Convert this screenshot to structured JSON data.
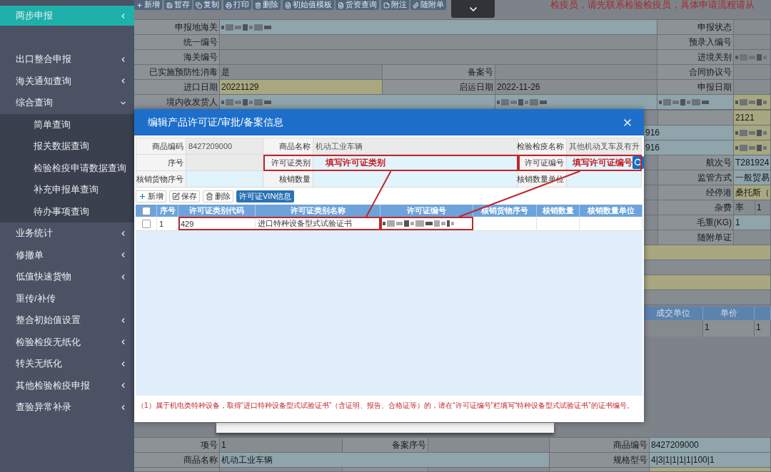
{
  "sidebar": {
    "items": [
      {
        "label": "两步申报",
        "kind": "group",
        "selected": true,
        "expanded": false
      },
      {
        "label": "出口整合申报",
        "kind": "group",
        "selected": false,
        "expanded": false
      },
      {
        "label": "海关通知查询",
        "kind": "group",
        "selected": false,
        "expanded": false
      },
      {
        "label": "综合查询",
        "kind": "group",
        "selected": false,
        "expanded": true,
        "children": [
          {
            "label": "简单查询",
            "selected": false
          },
          {
            "label": "报关数据查询",
            "selected": false
          },
          {
            "label": "检验检疫申请数据查询",
            "selected": false
          },
          {
            "label": "补充申报单查询",
            "selected": false
          },
          {
            "label": "待办事项查询",
            "selected": false
          }
        ]
      },
      {
        "label": "业务统计",
        "kind": "group",
        "selected": false,
        "expanded": false
      },
      {
        "label": "修撤单",
        "kind": "group",
        "selected": false,
        "expanded": false
      },
      {
        "label": "低值快速货物",
        "kind": "group",
        "selected": false,
        "expanded": false
      },
      {
        "label": "重传/补传",
        "kind": "link",
        "selected": false
      },
      {
        "label": "整合初始值设置",
        "kind": "group",
        "selected": false,
        "expanded": false
      },
      {
        "label": "检验检疫无纸化",
        "kind": "group",
        "selected": false,
        "expanded": false
      },
      {
        "label": "转关无纸化",
        "kind": "group",
        "selected": false,
        "expanded": false
      },
      {
        "label": "其他检验检疫申报",
        "kind": "group",
        "selected": false,
        "expanded": false
      },
      {
        "label": "查验异常补录",
        "kind": "group",
        "selected": false,
        "expanded": false
      }
    ]
  },
  "page_toolbar": {
    "buttons": [
      {
        "label": "新增",
        "kind": "add"
      },
      {
        "label": "暂存",
        "kind": "save"
      },
      {
        "label": "复制",
        "kind": "copy"
      },
      {
        "label": "打印",
        "kind": "print"
      },
      {
        "label": "删除",
        "kind": "delete"
      },
      {
        "label": "初始值模板",
        "kind": "template"
      },
      {
        "label": "货资查询",
        "kind": "query"
      },
      {
        "label": "附注",
        "kind": "note"
      },
      {
        "label": "随附单",
        "kind": "attachment"
      }
    ],
    "notice": "检疫员，请先联系检验检疫员，具体申请流程请从"
  },
  "viewer_toggle": {
    "expanded": false
  },
  "declaration_form": {
    "rows": [
      {
        "cells": [
          {
            "kind": "label",
            "text": "申报地海关"
          },
          {
            "kind": "input",
            "redacted": true
          },
          {
            "kind": "merged"
          },
          {
            "kind": "merged"
          },
          {
            "kind": "label",
            "text": "申报状态"
          },
          {
            "kind": "readonly"
          }
        ]
      },
      {
        "cells": [
          {
            "kind": "label",
            "text": "统一编号"
          },
          {
            "kind": "readonly"
          },
          {
            "kind": "merged"
          },
          {
            "kind": "merged"
          },
          {
            "kind": "label",
            "text": "预录入编号"
          },
          {
            "kind": "readonly"
          }
        ]
      },
      {
        "cells": [
          {
            "kind": "label",
            "text": "海关编号"
          },
          {
            "kind": "readonly"
          },
          {
            "kind": "merged"
          },
          {
            "kind": "merged"
          },
          {
            "kind": "label",
            "text": "进境关别"
          },
          {
            "kind": "readonly",
            "redacted": true
          }
        ]
      },
      {
        "cells": [
          {
            "kind": "label",
            "text": "已实施预防性消毒"
          },
          {
            "kind": "readonly",
            "text": "是"
          },
          {
            "kind": "label",
            "text": "备案号"
          },
          {
            "kind": "readonly"
          },
          {
            "kind": "label",
            "text": "合同协议号"
          },
          {
            "kind": "readonly"
          }
        ]
      },
      {
        "cells": [
          {
            "kind": "label",
            "text": "进口日期"
          },
          {
            "kind": "required",
            "text": "20221129"
          },
          {
            "kind": "label",
            "text": "启运日期"
          },
          {
            "kind": "readonly",
            "text": "2022-11-26"
          },
          {
            "kind": "label",
            "text": "申报日期"
          },
          {
            "kind": "readonly"
          }
        ]
      },
      {
        "cells": [
          {
            "kind": "label",
            "text": "境内收发货人"
          },
          {
            "kind": "input",
            "redacted": true
          },
          {
            "kind": "merged"
          },
          {
            "kind": "input",
            "redacted": true
          },
          {
            "kind": "input",
            "redacted": true
          },
          {
            "kind": "required",
            "redacted": true
          }
        ]
      }
    ]
  },
  "side_panel": {
    "rows": [
      {
        "cells": [
          {
            "kind": "blank"
          },
          {
            "kind": "label"
          },
          {
            "kind": "required",
            "text": "2121"
          },
          {
            "kind": "merged"
          }
        ]
      },
      {
        "cells": [
          {
            "kind": "input",
            "text": "916"
          },
          {
            "kind": "merged"
          },
          {
            "kind": "required",
            "redacted": true
          },
          {
            "kind": "merged"
          }
        ]
      },
      {
        "cells": [
          {
            "kind": "input",
            "text": "916"
          },
          {
            "kind": "merged"
          },
          {
            "kind": "required",
            "redacted": true
          },
          {
            "kind": "merged"
          }
        ]
      },
      {
        "cells": [
          {
            "kind": "blank"
          },
          {
            "kind": "label",
            "text": "航次号"
          },
          {
            "kind": "input",
            "text": "T281924"
          },
          {
            "kind": "merged"
          }
        ]
      },
      {
        "cells": [
          {
            "kind": "blank"
          },
          {
            "kind": "label",
            "text": "监管方式"
          },
          {
            "kind": "input",
            "text": "一般贸易"
          },
          {
            "kind": "merged"
          }
        ]
      },
      {
        "cells": [
          {
            "kind": "blank"
          },
          {
            "kind": "label",
            "text": "经停港"
          },
          {
            "kind": "required",
            "text": "桑托斯（"
          },
          {
            "kind": "merged"
          }
        ]
      },
      {
        "cells": [
          {
            "kind": "blank"
          },
          {
            "kind": "label",
            "text": "杂费"
          },
          {
            "kind": "readonly",
            "text": "率"
          },
          {
            "kind": "readonly",
            "text": "1"
          }
        ]
      },
      {
        "cells": [
          {
            "kind": "blank"
          },
          {
            "kind": "label",
            "text": "毛重(KG)"
          },
          {
            "kind": "input",
            "text": "1"
          },
          {
            "kind": "merged"
          }
        ]
      },
      {
        "cells": [
          {
            "kind": "blank"
          },
          {
            "kind": "label",
            "text": "随附单证"
          },
          {
            "kind": "readonly"
          },
          {
            "kind": "merged"
          }
        ]
      },
      {
        "cells": [
          {
            "kind": "required"
          },
          {
            "kind": "merged"
          },
          {
            "kind": "merged"
          },
          {
            "kind": "merged"
          }
        ]
      },
      {
        "cells": [
          {
            "kind": "readonly"
          },
          {
            "kind": "merged"
          },
          {
            "kind": "merged"
          },
          {
            "kind": "merged"
          }
        ]
      },
      {
        "cells": [
          {
            "kind": "required"
          },
          {
            "kind": "merged"
          },
          {
            "kind": "merged"
          },
          {
            "kind": "merged"
          }
        ]
      },
      {
        "cells": [
          {
            "kind": "readonly"
          },
          {
            "kind": "merged"
          },
          {
            "kind": "merged"
          },
          {
            "kind": "merged"
          }
        ]
      }
    ],
    "table": {
      "columns": [
        "成交单位",
        "单价"
      ],
      "rows": [
        {
          "cells": [
            {
              "kind": "blank"
            },
            {
              "kind": "value",
              "text": "1"
            },
            {
              "kind": "value",
              "text": "1"
            }
          ]
        }
      ]
    }
  },
  "bottom_form": {
    "rows": [
      {
        "cells": [
          {
            "kind": "label",
            "text": "项号"
          },
          {
            "kind": "readonly",
            "text": "1"
          },
          {
            "kind": "label",
            "text": "备案序号"
          },
          {
            "kind": "readonly"
          },
          {
            "kind": "label",
            "text": "商品编号"
          },
          {
            "kind": "input",
            "text": "8427209000"
          }
        ]
      },
      {
        "cells": [
          {
            "kind": "label",
            "text": "商品名称"
          },
          {
            "kind": "input",
            "text": "机动工业车辆"
          },
          {
            "kind": "merged"
          },
          {
            "kind": "merged"
          },
          {
            "kind": "label",
            "text": "规格型号"
          },
          {
            "kind": "input",
            "text": "4|3|1|1|1|1|100|1"
          }
        ]
      },
      {
        "cells": [
          {
            "kind": "label"
          },
          {
            "kind": "readonly"
          },
          {
            "kind": "label"
          },
          {
            "kind": "readonly"
          },
          {
            "kind": "label"
          },
          {
            "kind": "required"
          }
        ]
      }
    ]
  },
  "dialog": {
    "title": "编辑产品许可证/审批/备案信息",
    "form": {
      "rows": [
        {
          "fields": [
            {
              "label": "商品编码",
              "kind": "readonly",
              "value": "8427209000",
              "framed": false
            },
            {
              "label": "商品名称",
              "kind": "readonly",
              "value": "机动工业车辆",
              "framed": false
            },
            {
              "label": "检验检疫名称",
              "kind": "readonly",
              "value": "其他机动叉车及有升",
              "framed": false
            }
          ]
        },
        {
          "fields": [
            {
              "label": "序号",
              "kind": "readonly",
              "framed": false
            },
            {
              "label": "许可证类别",
              "kind": "input",
              "annotation": "填写许可证类别",
              "framed": true
            },
            {
              "label": "许可证编号",
              "kind": "input",
              "annotation": "填写许可证编号",
              "framed": true,
              "search_button": true
            }
          ]
        },
        {
          "fields": [
            {
              "label": "核销货物序号",
              "kind": "input",
              "framed": false
            },
            {
              "label": "核销数量",
              "kind": "input",
              "framed": false
            },
            {
              "label": "核销数量单位",
              "kind": "input",
              "framed": false
            }
          ]
        }
      ]
    },
    "toolbar": [
      {
        "label": "新增",
        "kind": "add",
        "selected": false
      },
      {
        "label": "保存",
        "kind": "save",
        "selected": false
      },
      {
        "label": "删除",
        "kind": "delete",
        "selected": false
      },
      {
        "label": "许可证VIN信息",
        "kind": "tab",
        "selected": true
      }
    ],
    "table": {
      "select_all_checked": false,
      "columns": [
        "序号",
        "许可证类别代码",
        "许可证类别名称",
        "许可证编号",
        "核销货物序号",
        "核销数量",
        "核销数量单位"
      ],
      "rows": [
        {
          "checked": false,
          "groups": [
            {
              "framed": false,
              "cells": [
                {
                  "text": "1"
                }
              ]
            },
            {
              "framed": true,
              "cells": [
                {
                  "text": "429"
                },
                {
                  "text": "进口特种设备型式试验证书"
                }
              ]
            },
            {
              "framed": true,
              "cells": [
                {
                  "redacted": true
                }
              ]
            }
          ]
        }
      ]
    },
    "note": "（1）属于机电类特种设备，取得“进口特种设备型式试验证书”（含证明、报告、合格证等）的，请在“许可证编号”栏填写“特种设备型式试验证书”的证书编号。"
  }
}
